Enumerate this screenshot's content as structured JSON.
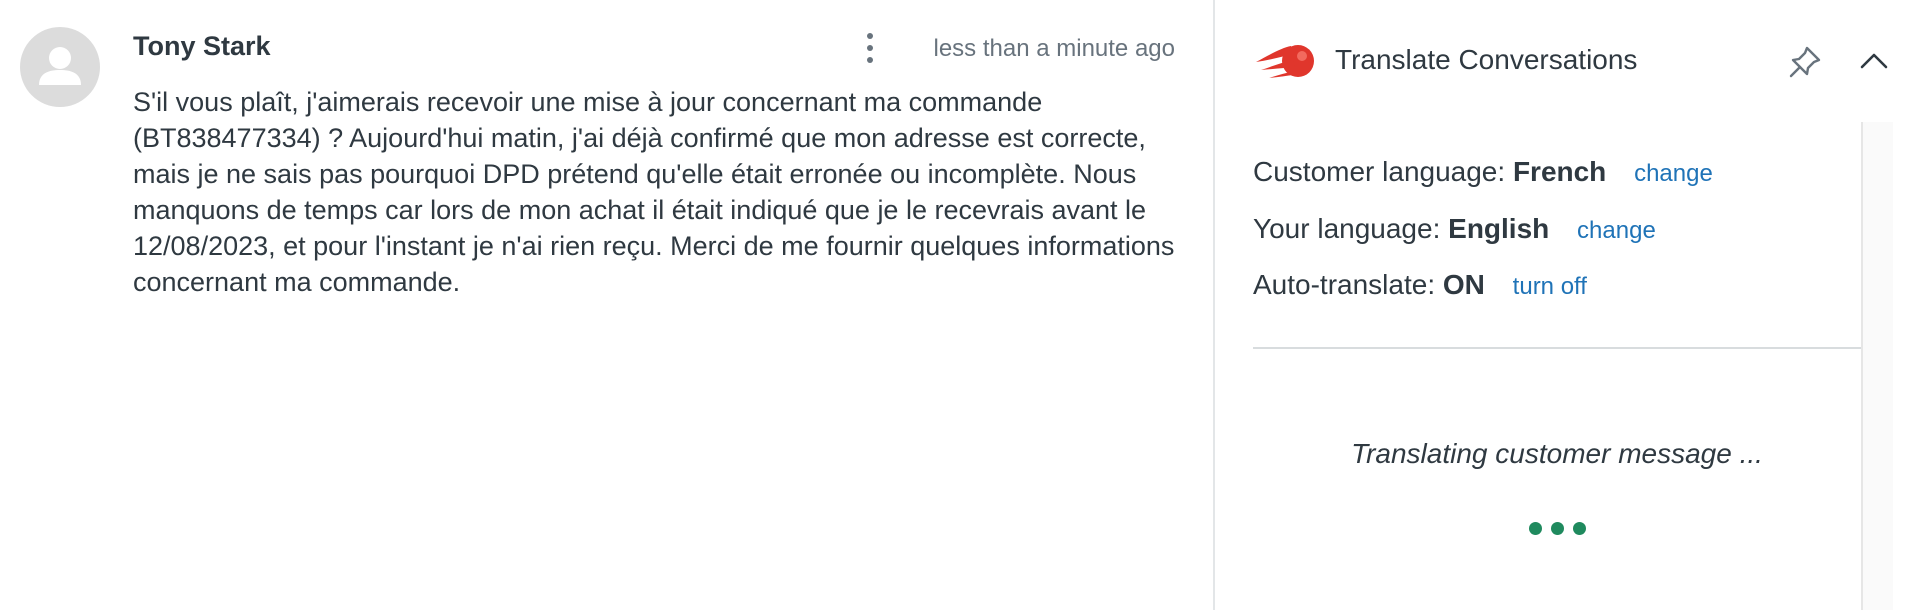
{
  "message": {
    "author": "Tony Stark",
    "timestamp": "less than a minute ago",
    "body": "S'il vous plaît, j'aimerais recevoir une mise à jour concernant ma commande (BT838477334) ? Aujourd'hui matin, j'ai déjà confirmé que mon adresse est correcte, mais je ne sais pas pourquoi DPD prétend qu'elle était erronée ou incomplète. Nous manquons de temps car lors de mon achat il était indiqué que je le recevrais avant le 12/08/2023, et pour l'instant je n'ai rien reçu. Merci de me fournir quelques informations concernant ma commande."
  },
  "panel": {
    "title": "Translate Conversations",
    "logo_icon": "comet-logo-icon",
    "pin_icon": "pin-icon",
    "collapse_icon": "chevron-up-icon",
    "customer_language": {
      "label": "Customer language:",
      "value": "French",
      "action": "change"
    },
    "your_language": {
      "label": "Your language:",
      "value": "English",
      "action": "change"
    },
    "auto_translate": {
      "label": "Auto-translate:",
      "value": "ON",
      "action": "turn off"
    },
    "status": "Translating customer message ...",
    "loader_dots": 3
  },
  "colors": {
    "link": "#1f73b7",
    "loader": "#1f8a5e",
    "logo": "#e0362c",
    "text": "#2f3941",
    "muted": "#68737d"
  }
}
